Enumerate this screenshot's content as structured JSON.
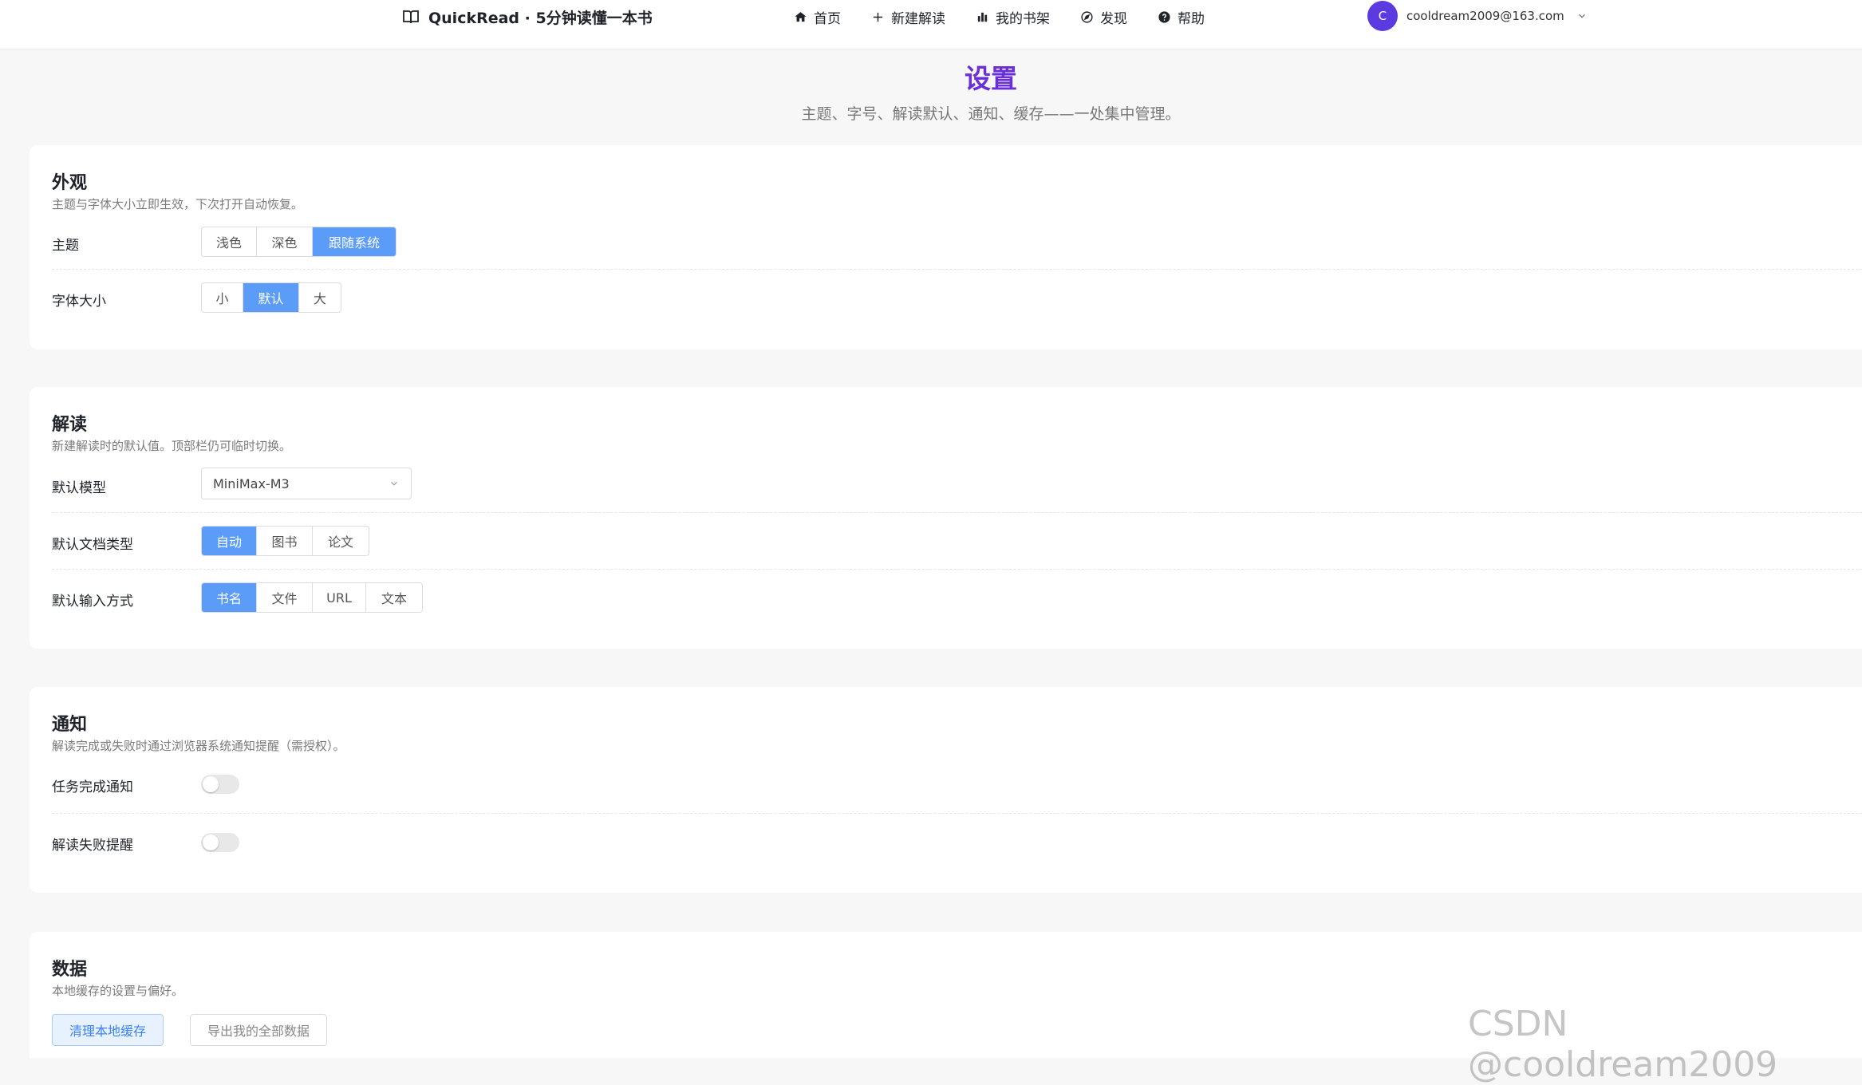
{
  "header": {
    "brand": "QuickRead · 5分钟读懂一本书",
    "nav": [
      {
        "label": "首页",
        "icon": "home-icon"
      },
      {
        "label": "新建解读",
        "icon": "plus-icon"
      },
      {
        "label": "我的书架",
        "icon": "bar-chart-icon"
      },
      {
        "label": "发现",
        "icon": "compass-icon"
      },
      {
        "label": "帮助",
        "icon": "help-circle-icon"
      }
    ],
    "user": {
      "initial": "C",
      "email": "cooldream2009@163.com"
    }
  },
  "page": {
    "title": "设置",
    "subtitle": "主题、字号、解读默认、通知、缓存——一处集中管理。"
  },
  "appearance": {
    "title": "外观",
    "desc": "主题与字体大小立即生效，下次打开自动恢复。",
    "theme": {
      "label": "主题",
      "options": [
        "浅色",
        "深色",
        "跟随系统"
      ],
      "selected": "跟随系统"
    },
    "font_size": {
      "label": "字体大小",
      "options": [
        "小",
        "默认",
        "大"
      ],
      "selected": "默认"
    }
  },
  "reading": {
    "title": "解读",
    "desc": "新建解读时的默认值。顶部栏仍可临时切换。",
    "model": {
      "label": "默认模型",
      "value": "MiniMax-M3"
    },
    "doc_type": {
      "label": "默认文档类型",
      "options": [
        "自动",
        "图书",
        "论文"
      ],
      "selected": "自动"
    },
    "input_mode": {
      "label": "默认输入方式",
      "options": [
        "书名",
        "文件",
        "URL",
        "文本"
      ],
      "selected": "书名"
    }
  },
  "notify": {
    "title": "通知",
    "desc": "解读完成或失败时通过浏览器系统通知提醒（需授权）。",
    "task_done": {
      "label": "任务完成通知",
      "enabled": false
    },
    "fail_alert": {
      "label": "解读失败提醒",
      "enabled": false
    }
  },
  "data": {
    "title": "数据",
    "desc": "本地缓存的设置与偏好。",
    "clear_label": "清理本地缓存",
    "export_label": "导出我的全部数据"
  },
  "watermark": "CSDN @cooldream2009",
  "colors": {
    "accent": "#5a9cf8",
    "title": "#6a2fd6",
    "avatar": "#5b3be0"
  }
}
